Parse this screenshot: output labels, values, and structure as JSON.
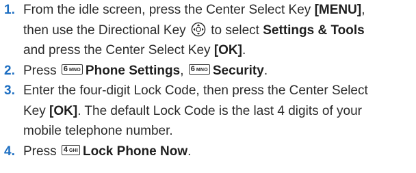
{
  "steps": [
    {
      "number": "1.",
      "lines": [
        {
          "before": "From the idle screen, press the Center Select Key ",
          "bold": "[MENU]",
          "after": ","
        },
        {
          "before": "then use the Directional Key ",
          "icon": "directional-key-icon",
          "between": " to select ",
          "bold": "Settings & Tools"
        },
        {
          "before": "and press the Center Select Key ",
          "bold": "[OK]",
          "after": "."
        }
      ]
    },
    {
      "number": "2.",
      "press": "Press ",
      "key1": {
        "digit": "6",
        "letters": "MNO"
      },
      "item1": "Phone Settings",
      "sep": ", ",
      "key2": {
        "digit": "6",
        "letters": "MNO"
      },
      "item2": "Security",
      "end": "."
    },
    {
      "number": "3.",
      "lines": [
        {
          "before": "Enter the four-digit Lock Code, then press the Center Select"
        },
        {
          "before": "Key ",
          "bold": "[OK]",
          "after": ". The default Lock Code is the last 4 digits of your"
        },
        {
          "before": "mobile telephone number."
        }
      ]
    },
    {
      "number": "4.",
      "press": "Press ",
      "key1": {
        "digit": "4",
        "letters": "GHI"
      },
      "item1": "Lock Phone Now",
      "end": "."
    }
  ],
  "colors": {
    "step_number": "#1e6fc2",
    "text": "#2b2b2b"
  }
}
